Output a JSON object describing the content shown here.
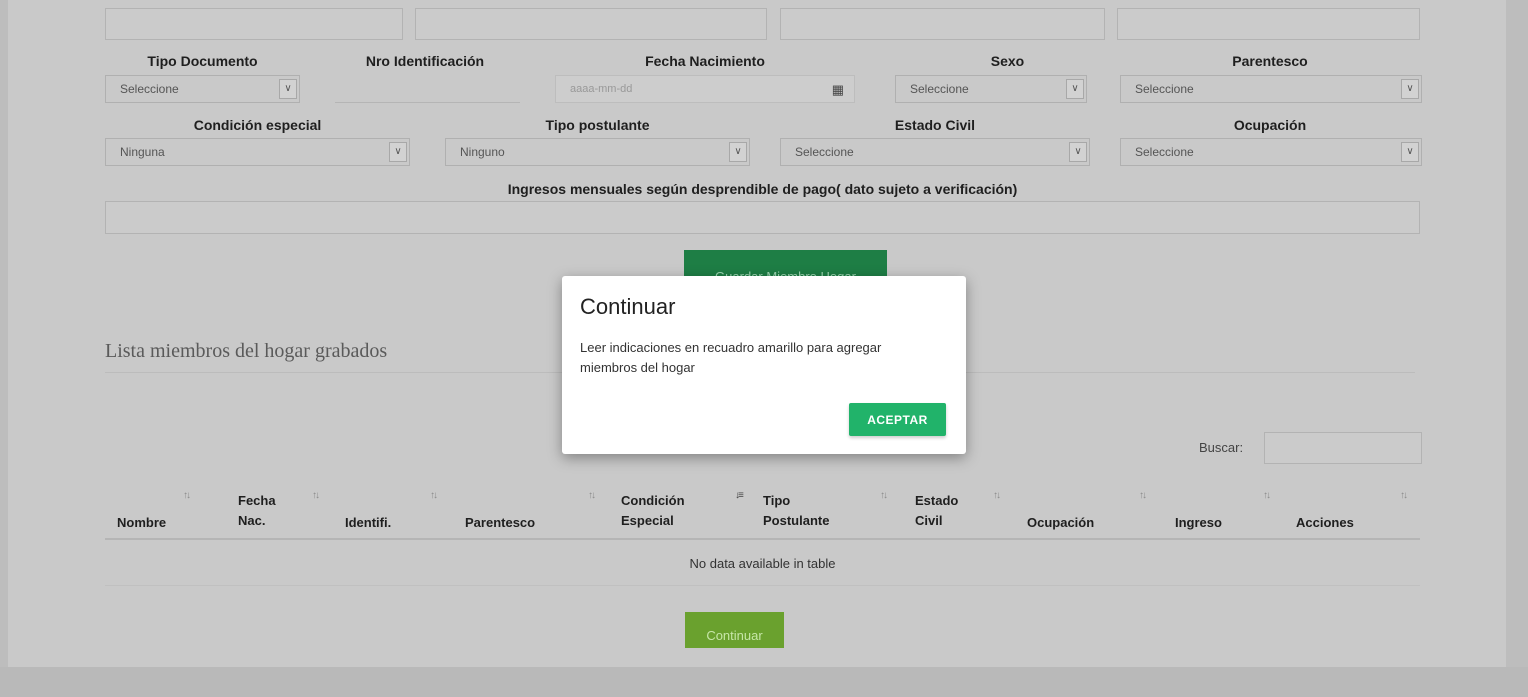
{
  "form": {
    "row1_labels": {
      "tipo_documento": "Tipo Documento",
      "nro_identificacion": "Nro Identificación",
      "fecha_nacimiento": "Fecha Nacimiento",
      "sexo": "Sexo",
      "parentesco": "Parentesco"
    },
    "row1_values": {
      "tipo_documento": "Seleccione",
      "fecha_nacimiento_placeholder": "aaaa-mm-dd",
      "sexo": "Seleccione",
      "parentesco": "Seleccione"
    },
    "row2_labels": {
      "condicion_especial": "Condición especial",
      "tipo_postulante": "Tipo postulante",
      "estado_civil": "Estado Civil",
      "ocupacion": "Ocupación"
    },
    "row2_values": {
      "condicion_especial": "Ninguna",
      "tipo_postulante": "Ninguno",
      "estado_civil": "Seleccione",
      "ocupacion": "Seleccione"
    },
    "ingresos_label": "Ingresos mensuales según desprendible de pago( dato sujeto a verificación)",
    "save_button": "Guardar Miembro Hogar"
  },
  "list": {
    "title": "Lista miembros del hogar grabados",
    "search_label": "Buscar:",
    "columns": [
      {
        "line1": "Nombre",
        "line2": ""
      },
      {
        "line1": "Fecha",
        "line2": "Nac."
      },
      {
        "line1": "Identifi.",
        "line2": ""
      },
      {
        "line1": "Parentesco",
        "line2": ""
      },
      {
        "line1": "Condición",
        "line2": "Especial"
      },
      {
        "line1": "Tipo",
        "line2": "Postulante"
      },
      {
        "line1": "Estado",
        "line2": "Civil"
      },
      {
        "line1": "Ocupación",
        "line2": ""
      },
      {
        "line1": "Ingreso",
        "line2": ""
      },
      {
        "line1": "Acciones",
        "line2": ""
      }
    ],
    "empty_message": "No data available in table",
    "continue_button": "Continuar"
  },
  "modal": {
    "title": "Continuar",
    "body": "Leer indicaciones en recuadro amarillo para agregar miembros del hogar",
    "accept_button": "ACEPTAR"
  },
  "colors": {
    "save_button": "#1e7e45",
    "continue_button": "#6aa12e",
    "accept_button": "#21b36a"
  }
}
